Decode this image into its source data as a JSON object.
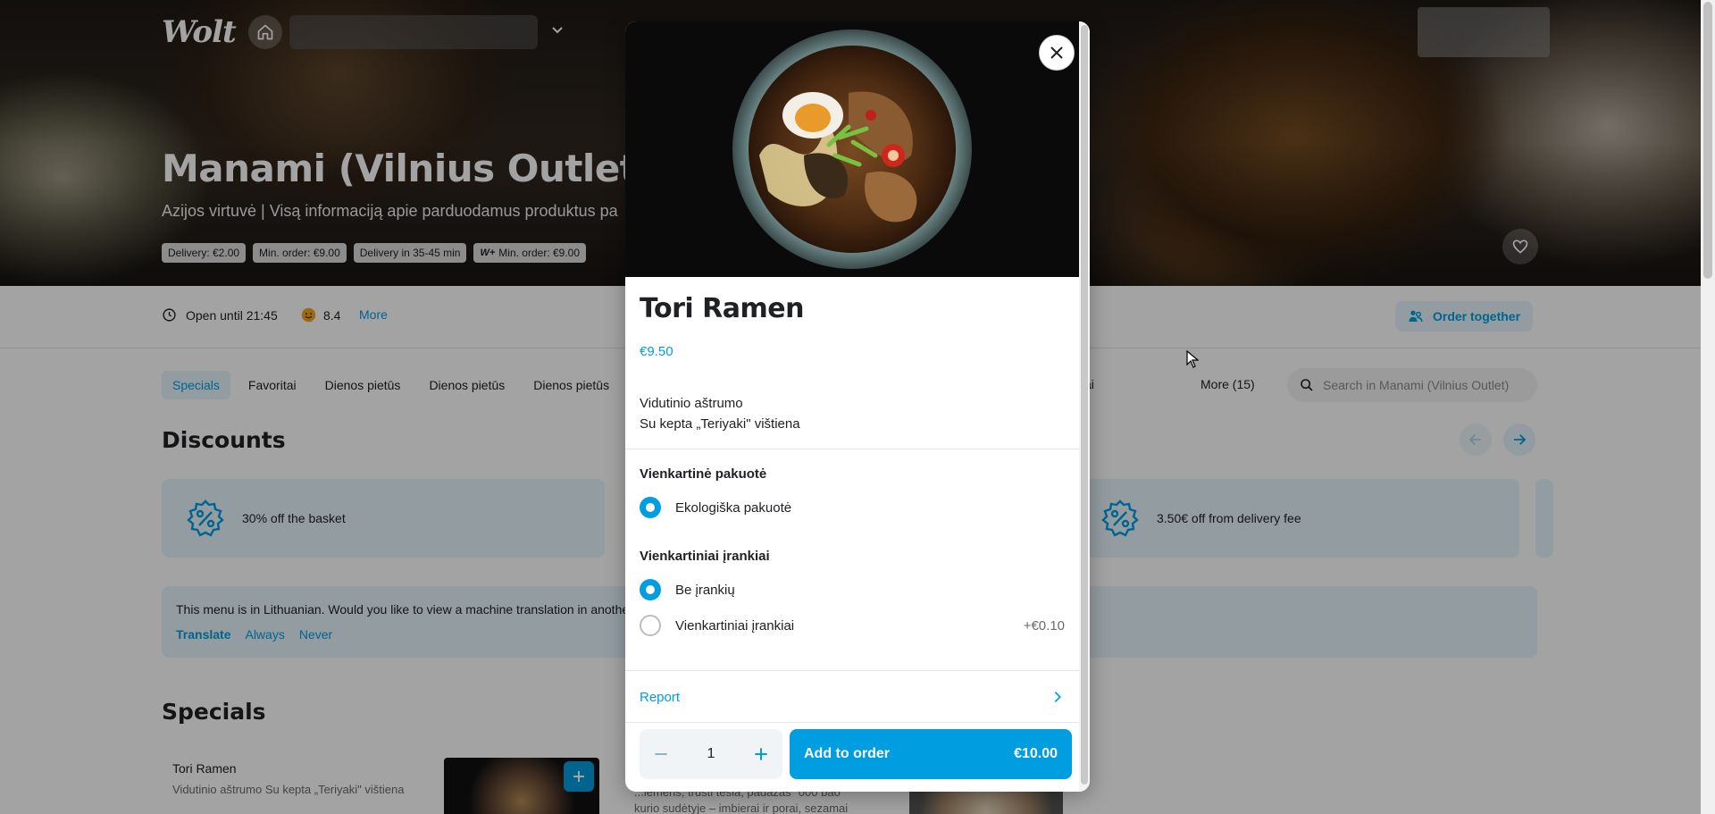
{
  "header": {
    "logo": "Wolt"
  },
  "restaurant": {
    "title": "Manami (Vilnius Outlet)",
    "subtitle": "Azijos virtuvė | Visą informaciją apie parduodamus produktus pa",
    "chips": [
      "Delivery: €2.00",
      "Min. order: €9.00",
      "Delivery in 35-45 min"
    ],
    "wplus_chip": {
      "badge": "W+",
      "text": "Min. order: €9.00"
    }
  },
  "infobar": {
    "open_time": "Open until 21:45",
    "rating": "8.4",
    "more": "More",
    "order_together": "Order together"
  },
  "tabs": {
    "items": [
      "Specials",
      "Favoritai",
      "Dienos pietūs",
      "Dienos pietūs",
      "Dienos pietūs"
    ],
    "partial": "ai",
    "more": "More (15)",
    "search_placeholder": "Search in Manami (Vilnius Outlet)"
  },
  "discounts": {
    "title": "Discounts",
    "cards": [
      "30% off the basket",
      "3.50€ off from delivery fee"
    ]
  },
  "translate": {
    "message": "This menu is in Lithuanian. Would you like to view a machine translation in anothe",
    "translate": "Translate",
    "always": "Always",
    "never": "Never"
  },
  "specials": {
    "title": "Specials",
    "item_name": "Tori Ramen",
    "item_desc": "Vidutinio aštrumo Su kepta „Teriyaki\" vištiena",
    "other_desc_line1": "...lemens, trušti tešla, padažas \"000 bao\"",
    "other_desc_line2": "kurio sudėtyje – imbierai ir porai, sezamai"
  },
  "modal": {
    "title": "Tori Ramen",
    "price": "€9.50",
    "desc_line1": "Vidutinio aštrumo",
    "desc_line2": "Su kepta „Teriyaki\" vištiena",
    "group1": {
      "title": "Vienkartinė pakuotė",
      "options": [
        {
          "label": "Ekologiška pakuotė",
          "price": "",
          "checked": true
        }
      ]
    },
    "group2": {
      "title": "Vienkartiniai įrankiai",
      "options": [
        {
          "label": "Be įrankių",
          "price": "",
          "checked": true
        },
        {
          "label": "Vienkartiniai įrankiai",
          "price": "+€0.10",
          "checked": false
        }
      ]
    },
    "report": "Report",
    "quantity": "1",
    "add_label": "Add to order",
    "total": "€10.00"
  },
  "colors": {
    "accent": "#009de0",
    "accent_light": "#e6f5fc",
    "text": "#202125"
  }
}
